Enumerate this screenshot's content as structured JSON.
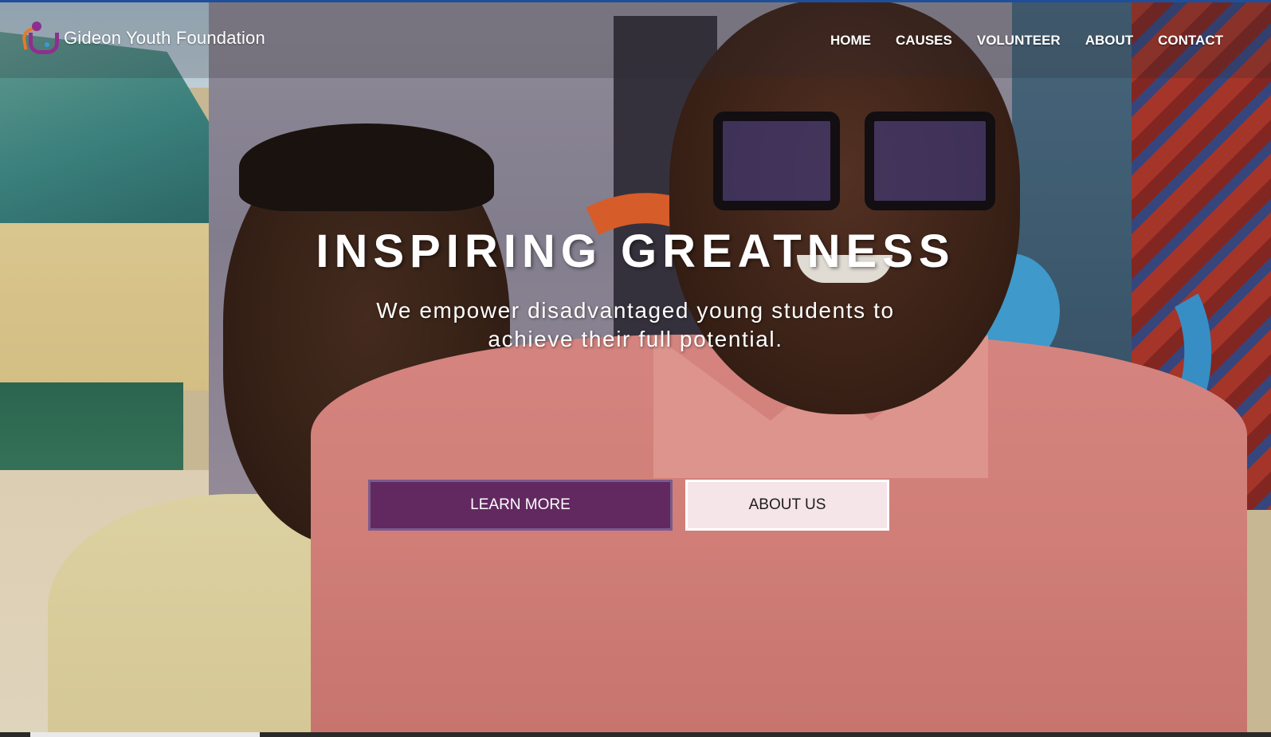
{
  "header": {
    "logo_text": "Gideon Youth Foundation",
    "nav": [
      "HOME",
      "CAUSES",
      "VOLUNTEER",
      "ABOUT",
      "CONTACT"
    ]
  },
  "hero": {
    "title": "INSPIRING GREATNESS",
    "subtitle_line1": "We empower disadvantaged young students to",
    "subtitle_line2": "achieve their full potential.",
    "primary_button": "LEARN MORE",
    "secondary_button": "ABOUT US"
  },
  "colors": {
    "primary_button_bg": "#48165a",
    "secondary_button_bg": "#f8f0f4",
    "logo_purple": "#8e2f8e",
    "logo_orange": "#e67a2a",
    "logo_blue": "#3a9bd6"
  }
}
